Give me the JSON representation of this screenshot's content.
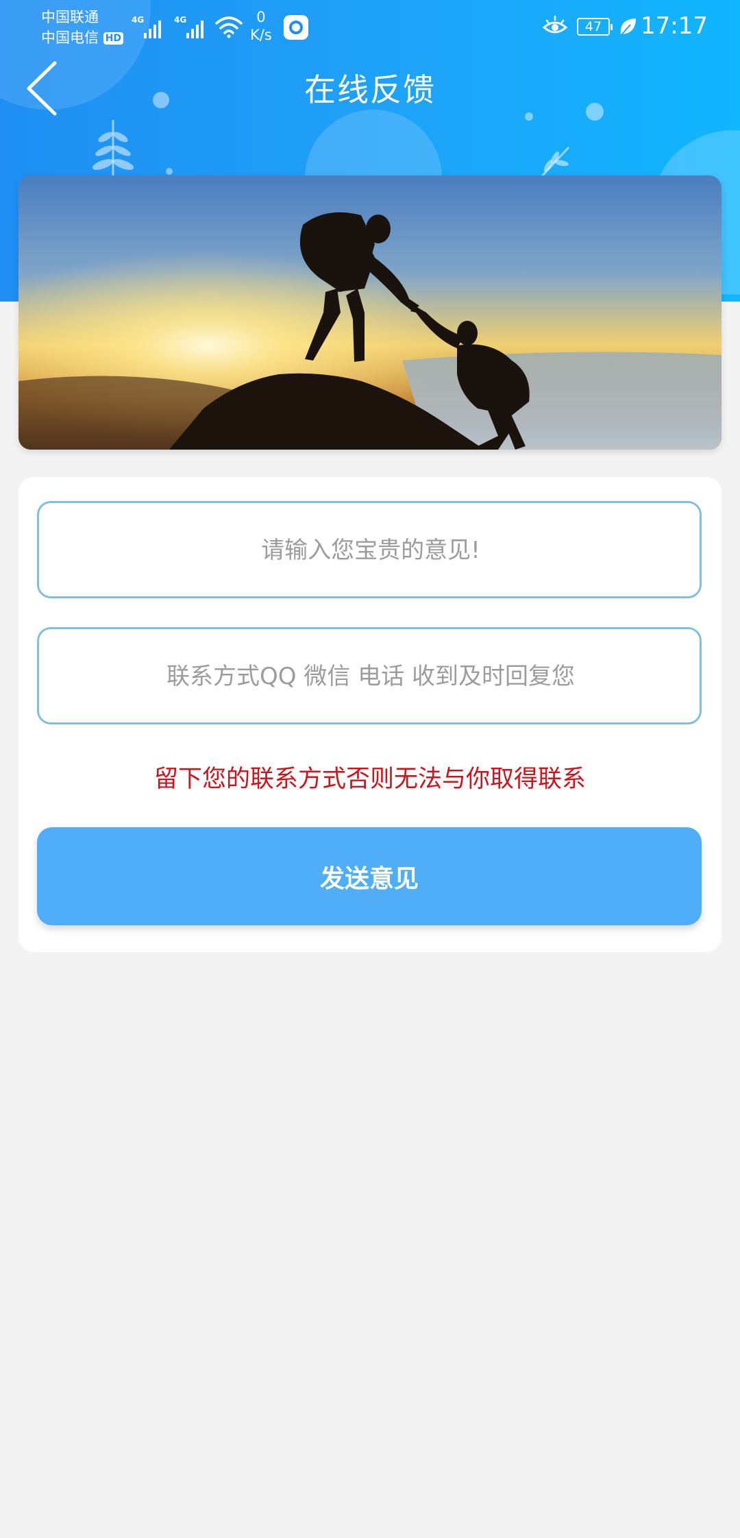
{
  "status_bar": {
    "carrier_1": "中国联通",
    "carrier_2": "中国电信",
    "hd_badge": "HD",
    "network_1": "4G",
    "network_2": "4G",
    "speed_value": "0",
    "speed_unit": "K/s",
    "battery_level": "47",
    "time": "17:17"
  },
  "header": {
    "title": "在线反馈",
    "back_icon": "chevron-left-icon"
  },
  "banner": {
    "image_subject": "two-climbers-sunset-photo"
  },
  "form": {
    "feedback_input": {
      "value": "",
      "placeholder": "请输入您宝贵的意见!"
    },
    "contact_input": {
      "value": "",
      "placeholder": "联系方式QQ 微信 电话 收到及时回复您"
    },
    "warning": "留下您的联系方式否则无法与你取得联系",
    "submit_label": "发送意见"
  },
  "colors": {
    "header_blue": "#1f8ff3",
    "button_blue": "#50adf7",
    "input_border": "#7ec1de",
    "warning_red": "#d0121b",
    "page_bg": "#f3f3f3"
  }
}
